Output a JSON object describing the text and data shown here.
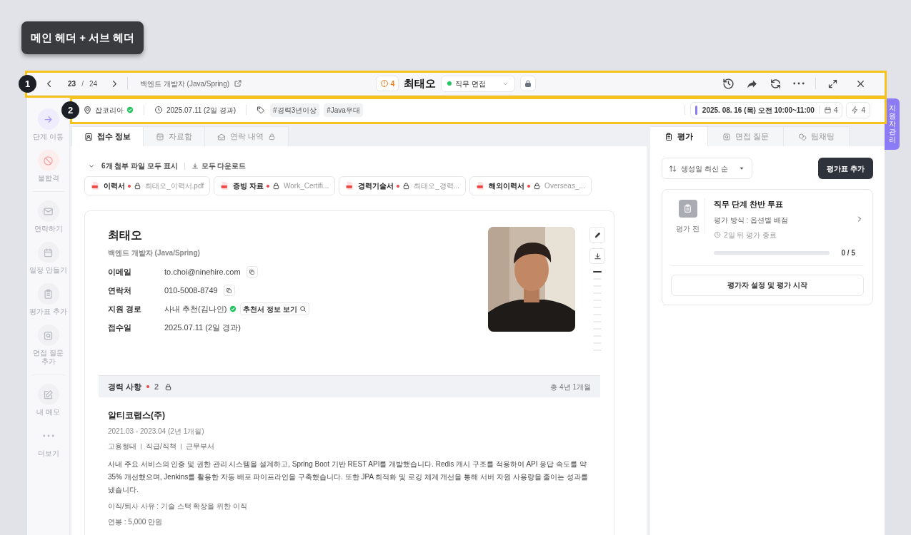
{
  "annotation_label": "메인 헤더 + 서브 헤더",
  "callouts": [
    "1",
    "2"
  ],
  "header": {
    "current": "23",
    "separator": "/",
    "total": "24",
    "job_title": "백엔드 개발자 (Java/Spring)",
    "alert_count": "4",
    "candidate_name": "최태오",
    "stage": {
      "label": "직무 면접",
      "color": "#22c55e"
    }
  },
  "sub_header": {
    "source": "잡코리아",
    "source_verified": true,
    "applied": "2025.07.11 (2일 경과)",
    "tags": [
      "#경력3년이상",
      "#Java우대"
    ],
    "schedule": "2025. 08. 16 (목) 오전 10:00~11:00",
    "calendar_count": "4",
    "flash_count": "4"
  },
  "side_tab": "지원자 관리",
  "action_rail": [
    [
      {
        "kind": "move",
        "label": "단계 이동"
      },
      {
        "kind": "reject",
        "label": "불합격"
      }
    ],
    [
      {
        "kind": "contact",
        "label": "연락하기"
      },
      {
        "kind": "schedule",
        "label": "일정 만들기"
      },
      {
        "kind": "evaluation",
        "label": "평가표 추가"
      },
      {
        "kind": "question",
        "label": "면접 질문 추가"
      }
    ],
    [
      {
        "kind": "memo",
        "label": "내 메모"
      },
      {
        "kind": "more",
        "label": "더보기"
      }
    ]
  ],
  "left_tabs": [
    {
      "kind": "profile",
      "label": "접수 정보",
      "selected": true,
      "locked": false
    },
    {
      "kind": "files",
      "label": "자료함",
      "selected": false,
      "locked": false
    },
    {
      "kind": "contact",
      "label": "연락 내역",
      "selected": false,
      "locked": true
    }
  ],
  "attachments": {
    "toggle": "6개 첨부 파일 모두 표시",
    "download": "모두 다운로드",
    "files": [
      {
        "type": "이력서",
        "required": true,
        "locked": true,
        "name": "최태오_이력서.pdf"
      },
      {
        "type": "증빙 자료",
        "required": true,
        "locked": true,
        "name": "Work_Certifi..."
      },
      {
        "type": "경력기술서",
        "required": true,
        "locked": true,
        "name": "최태오_경력..."
      },
      {
        "type": "해외이력서",
        "required": true,
        "locked": true,
        "name": "Overseas_..."
      }
    ]
  },
  "profile": {
    "name": "최태오",
    "role": "백엔드 개발자 (Java/Spring)",
    "fields": [
      {
        "kind": "copy",
        "label": "이메일",
        "value": "to.choi@ninehire.com"
      },
      {
        "kind": "copy",
        "label": "연락처",
        "value": "010-5008-8749"
      },
      {
        "kind": "referral",
        "label": "지원 경로",
        "value": "사내 추천(김나인)",
        "verified": true,
        "action": "추천서 정보 보기"
      },
      {
        "kind": "plain",
        "label": "접수일",
        "value": "2025.07.11 (2일 경과)"
      }
    ]
  },
  "career": {
    "title": "경력 사항",
    "required": true,
    "count": "2",
    "locked": true,
    "total": "총 4년 1개월",
    "entries": [
      {
        "company": "알티코랩스(주)",
        "period": "2021.03 - 2023.04 (2년 1개월)",
        "meta": [
          "고용형태",
          "직급/직책",
          "근무부서"
        ],
        "description": "사내 주요 서비스의 인증 및 권한 관리 시스템을 설계하고, Spring Boot 기반 REST API를 개발했습니다. Redis 캐시 구조를 적용하여 API 응답 속도를 약 35% 개선했으며, Jenkins를 활용한 자동 배포 파이프라인을 구축했습니다. 또한 JPA 최적화 및 로깅 체계 개선을 통해 서버 자원 사용량을 줄이는 성과를 냈습니다.",
        "reason": "이직/퇴사 사유 : 기술 스택 확장을 위한 이직",
        "salary": "연봉 : 5,000 만원"
      }
    ]
  },
  "right_tabs": [
    {
      "kind": "evaluation",
      "label": "평가",
      "selected": true
    },
    {
      "kind": "question",
      "label": "면접 질문",
      "selected": false
    },
    {
      "kind": "chat",
      "label": "팀채팅",
      "selected": false
    }
  ],
  "sort": "생성일 최신 순",
  "add_button": "평가표 추가",
  "evaluation": {
    "status": "평가 전",
    "title": "직무 단계 찬반 투표",
    "method": "평가 방식 : 옵션별 배점",
    "deadline": "2일 뒤 평가 종료",
    "level": 0,
    "progress": "0 / 5",
    "start_button": "평가자 설정 및 평가 시작"
  }
}
